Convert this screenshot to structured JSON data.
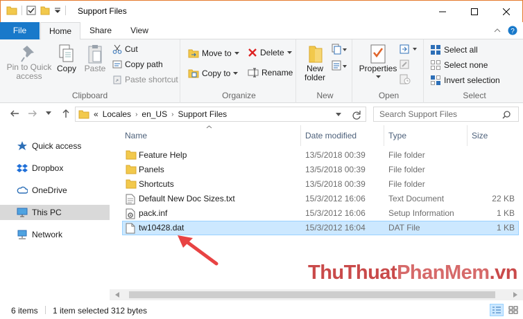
{
  "window": {
    "title": "Support Files"
  },
  "tabs": {
    "file": "File",
    "home": "Home",
    "share": "Share",
    "view": "View"
  },
  "ribbon": {
    "clipboard": {
      "label": "Clipboard",
      "pin": "Pin to Quick access",
      "copy": "Copy",
      "paste": "Paste",
      "cut": "Cut",
      "copy_path": "Copy path",
      "paste_shortcut": "Paste shortcut"
    },
    "organize": {
      "label": "Organize",
      "move_to": "Move to",
      "copy_to": "Copy to",
      "delete": "Delete",
      "rename": "Rename"
    },
    "new": {
      "label": "New",
      "new_folder": "New folder"
    },
    "open": {
      "label": "Open",
      "properties": "Properties"
    },
    "select": {
      "label": "Select",
      "select_all": "Select all",
      "select_none": "Select none",
      "invert": "Invert selection"
    }
  },
  "address": {
    "overflow": "«",
    "crumbs": [
      "Locales",
      "en_US",
      "Support Files"
    ],
    "search_placeholder": "Search Support Files"
  },
  "sidebar": {
    "items": [
      {
        "label": "Quick access"
      },
      {
        "label": "Dropbox"
      },
      {
        "label": "OneDrive"
      },
      {
        "label": "This PC"
      },
      {
        "label": "Network"
      }
    ]
  },
  "columns": {
    "name": "Name",
    "date": "Date modified",
    "type": "Type",
    "size": "Size"
  },
  "files": [
    {
      "name": "Feature Help",
      "date": "13/5/2018 00:39",
      "type": "File folder",
      "size": ""
    },
    {
      "name": "Panels",
      "date": "13/5/2018 00:39",
      "type": "File folder",
      "size": ""
    },
    {
      "name": "Shortcuts",
      "date": "13/5/2018 00:39",
      "type": "File folder",
      "size": ""
    },
    {
      "name": "Default New Doc Sizes.txt",
      "date": "15/3/2012 16:06",
      "type": "Text Document",
      "size": "22 KB"
    },
    {
      "name": "pack.inf",
      "date": "15/3/2012 16:06",
      "type": "Setup Information",
      "size": "1 KB"
    },
    {
      "name": "tw10428.dat",
      "date": "15/3/2012 16:04",
      "type": "DAT File",
      "size": "1 KB"
    }
  ],
  "status": {
    "items": "6 items",
    "selected": "1 item selected",
    "size": "312 bytes"
  },
  "watermark": {
    "part1": "ThuThuat",
    "part2": "PhanMem",
    "part3": ".vn"
  },
  "colors": {
    "accent": "#1979ca",
    "selection": "#cce8ff",
    "folder": "#f2c94c",
    "arrow": "#e84343"
  }
}
